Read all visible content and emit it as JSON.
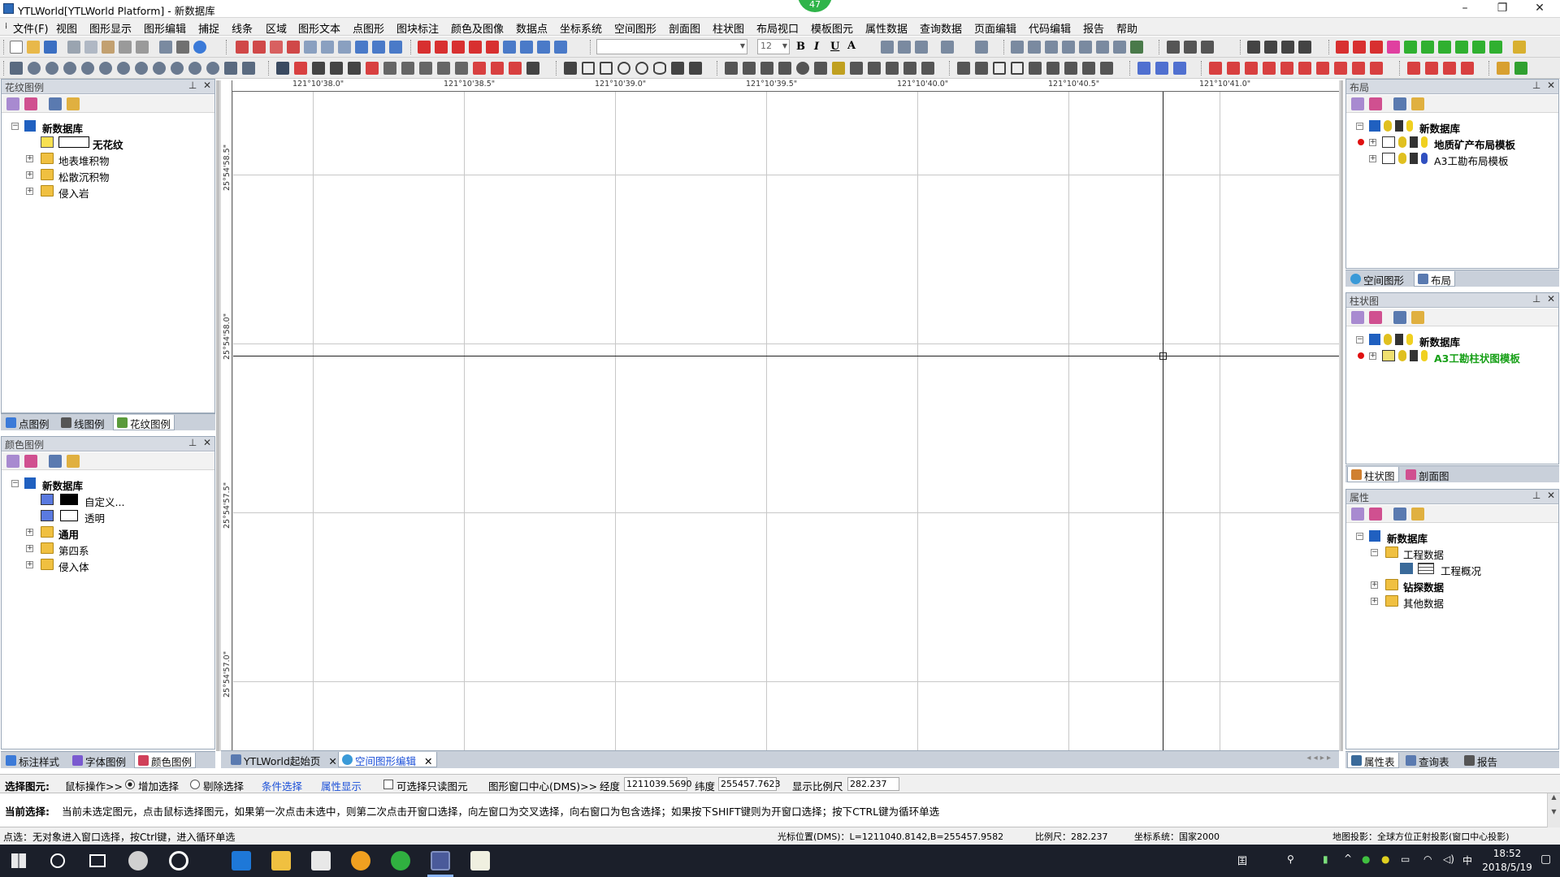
{
  "window": {
    "title": "YTLWorld[YTLWorld Platform] - 新数据库",
    "badge": "47"
  },
  "menu": [
    "文件(F)",
    "视图",
    "图形显示",
    "图形编辑",
    "捕捉",
    "线条",
    "区域",
    "图形文本",
    "点图形",
    "图块标注",
    "颜色及图像",
    "数据点",
    "坐标系统",
    "空间图形",
    "剖面图",
    "柱状图",
    "布局视口",
    "模板图元",
    "属性数据",
    "查询数据",
    "页面编辑",
    "代码编辑",
    "报告",
    "帮助"
  ],
  "toolbar": {
    "font_size": "12",
    "bold": "B",
    "italic": "I",
    "underline": "U",
    "font_color": "A"
  },
  "pattern_panel": {
    "title": "花纹图例",
    "root": "新数据库",
    "items": [
      {
        "label": "无花纹"
      },
      {
        "label": "地表堆积物"
      },
      {
        "label": "松散沉积物"
      },
      {
        "label": "侵入岩"
      }
    ],
    "tabs": [
      "点图例",
      "线图例",
      "花纹图例"
    ]
  },
  "color_panel": {
    "title": "颜色图例",
    "root": "新数据库",
    "items": [
      {
        "label": "自定义...",
        "color": "#000000"
      },
      {
        "label": "透明",
        "color": "#ffffff"
      },
      {
        "label": "通用"
      },
      {
        "label": "第四系"
      },
      {
        "label": "侵入体"
      }
    ],
    "tabs": [
      "标注样式",
      "字体图例",
      "颜色图例"
    ]
  },
  "layout_panel": {
    "title": "布局",
    "root": "新数据库",
    "items": [
      {
        "label": "地质矿产布局模板"
      },
      {
        "label": "A3工勘布局模板"
      }
    ],
    "tabs": [
      "空间图形",
      "布局"
    ]
  },
  "column_panel": {
    "title": "柱状图",
    "root": "新数据库",
    "items": [
      {
        "label": "A3工勘柱状图模板"
      }
    ],
    "tabs": [
      "柱状图",
      "剖面图"
    ]
  },
  "attr_panel": {
    "title": "属性",
    "root": "新数据库",
    "items": [
      {
        "label": "工程数据"
      },
      {
        "label": "工程概况"
      },
      {
        "label": "钻探数据"
      },
      {
        "label": "其他数据"
      }
    ],
    "tabs": [
      "属性表",
      "查询表",
      "报告"
    ]
  },
  "canvas": {
    "corner": "LB",
    "x_ticks": [
      "121°10'38.0\"",
      "121°10'38.5\"",
      "121°10'39.0\"",
      "121°10'39.5\"",
      "121°10'40.0\"",
      "121°10'40.5\"",
      "121°10'41.0\""
    ],
    "y_ticks": [
      "25°54'58.5\"",
      "25°54'58.0\"",
      "25°54'57.5\"",
      "25°54'57.0\""
    ]
  },
  "doc_tabs": [
    "YTLWorld起始页",
    "空间图形编辑"
  ],
  "selection_bar": {
    "label": "选择图元:",
    "mouse_op": "鼠标操作>>",
    "add_sel": "增加选择",
    "del_sel": "剔除选择",
    "cond_sel": "条件选择",
    "attr_show": "属性显示",
    "readonly_sel": "可选择只读图元",
    "center": "图形窗口中心(DMS)>>",
    "lon_label": "经度",
    "lon": "1211039.5690",
    "lat_label": "纬度",
    "lat": "255457.7623",
    "scale_label": "显示比例尺",
    "scale": "282.237"
  },
  "hint": {
    "label": "当前选择:",
    "text": "当前未选定图元，点击鼠标选择图元，如果第一次点击未选中，则第二次点击开窗口选择，向左窗口为交叉选择，向右窗口为包含选择；如果按下SHIFT键则为开窗口选择；按下CTRL键为循环单选"
  },
  "status": {
    "left": "点选：无对象进入窗口选择，按Ctrl键，进入循环单选",
    "cursor": "光标位置(DMS)：L=1211040.8142,B=255457.9582",
    "scale": "比例尺：282.237",
    "coord": "坐标系统：国家2000",
    "proj": "地图投影：全球方位正射投影(窗口中心投影)"
  },
  "taskbar": {
    "time": "18:52",
    "date": "2018/5/19"
  }
}
